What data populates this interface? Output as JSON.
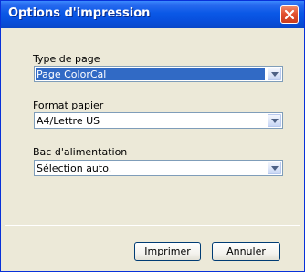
{
  "window": {
    "title": "Options d'impression"
  },
  "fields": [
    {
      "label": "Type de page",
      "value": "Page ColorCal",
      "selected": true
    },
    {
      "label": "Format papier",
      "value": "A4/Lettre US",
      "selected": false
    },
    {
      "label": "Bac d'alimentation",
      "value": "Sélection auto.",
      "selected": false
    }
  ],
  "buttons": {
    "print_label": "Imprimer",
    "cancel_label": "Annuler"
  },
  "colors": {
    "titlebar": "#0a58e6",
    "dialog_bg": "#ece9d8",
    "selection": "#316ac5",
    "close": "#e2502f"
  },
  "icons": {
    "close": "close-icon",
    "dropdown": "chevron-down-icon"
  }
}
